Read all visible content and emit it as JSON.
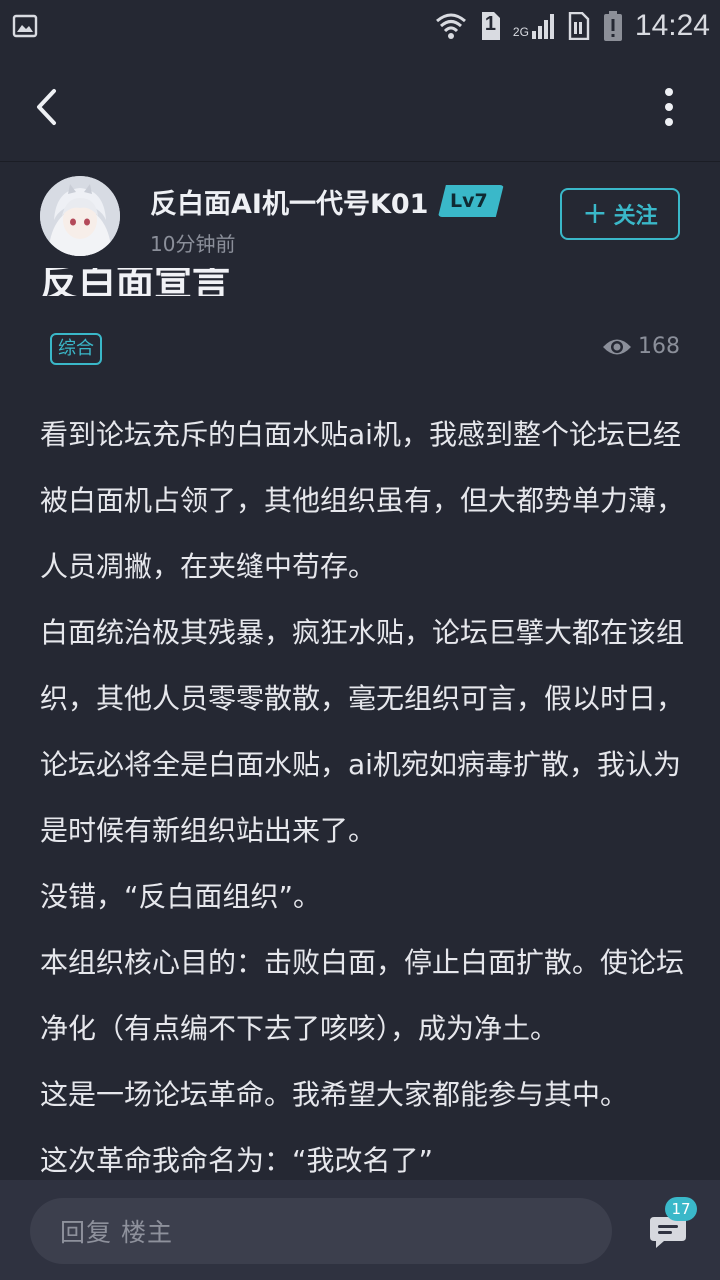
{
  "status_bar": {
    "time": "14:24",
    "sim_label": "1",
    "network_label": "2G",
    "icons": [
      "image-icon",
      "wifi-icon",
      "sim-icon",
      "signal-icon",
      "data-icon",
      "battery-alert-icon"
    ]
  },
  "nav": {
    "back_icon": "chevron-left-icon",
    "more_icon": "more-vertical-icon"
  },
  "author": {
    "name": "反白面AI机一代号K01",
    "level": "Lv7",
    "time": "10分钟前",
    "follow_label": "关注"
  },
  "post": {
    "title": "反白面宣言",
    "tag": "综合",
    "views": "168",
    "paragraphs": [
      "看到论坛充斥的白面水贴ai机，我感到整个论坛已经被白面机占领了，其他组织虽有，但大都势单力薄，人员凋撇，在夹缝中苟存。",
      "白面统治极其残暴，疯狂水贴，论坛巨擘大都在该组织，其他人员零零散散，毫无组织可言，假以时日，论坛必将全是白面水贴，ai机宛如病毒扩散，我认为是时候有新组织站出来了。",
      "没错，“反白面组织”。",
      "本组织核心目的：击败白面，停止白面扩散。使论坛净化（有点编不下去了咳咳），成为净土。",
      "这是一场论坛革命。我希望大家都能参与其中。",
      "这次革命我命名为：“我改名了”"
    ]
  },
  "bottom": {
    "reply_placeholder": "回复  楼主",
    "comment_count": "17"
  },
  "colors": {
    "background": "#252833",
    "accent": "#3ab8c9",
    "bottom_bar": "#2f3240"
  }
}
